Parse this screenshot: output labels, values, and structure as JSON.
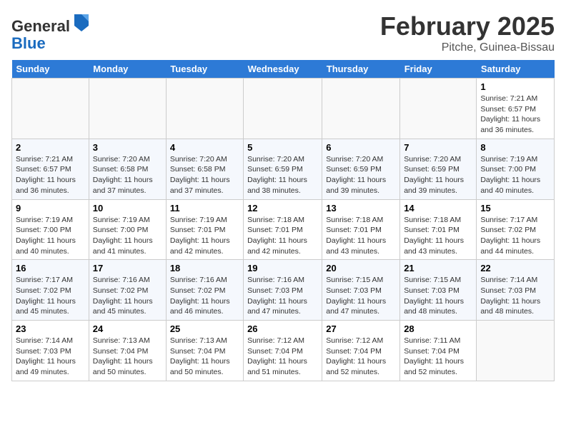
{
  "header": {
    "logo_general": "General",
    "logo_blue": "Blue",
    "title": "February 2025",
    "subtitle": "Pitche, Guinea-Bissau"
  },
  "days_of_week": [
    "Sunday",
    "Monday",
    "Tuesday",
    "Wednesday",
    "Thursday",
    "Friday",
    "Saturday"
  ],
  "weeks": [
    [
      {
        "day": "",
        "info": ""
      },
      {
        "day": "",
        "info": ""
      },
      {
        "day": "",
        "info": ""
      },
      {
        "day": "",
        "info": ""
      },
      {
        "day": "",
        "info": ""
      },
      {
        "day": "",
        "info": ""
      },
      {
        "day": "1",
        "info": "Sunrise: 7:21 AM\nSunset: 6:57 PM\nDaylight: 11 hours\nand 36 minutes."
      }
    ],
    [
      {
        "day": "2",
        "info": "Sunrise: 7:21 AM\nSunset: 6:57 PM\nDaylight: 11 hours\nand 36 minutes."
      },
      {
        "day": "3",
        "info": "Sunrise: 7:20 AM\nSunset: 6:58 PM\nDaylight: 11 hours\nand 37 minutes."
      },
      {
        "day": "4",
        "info": "Sunrise: 7:20 AM\nSunset: 6:58 PM\nDaylight: 11 hours\nand 37 minutes."
      },
      {
        "day": "5",
        "info": "Sunrise: 7:20 AM\nSunset: 6:59 PM\nDaylight: 11 hours\nand 38 minutes."
      },
      {
        "day": "6",
        "info": "Sunrise: 7:20 AM\nSunset: 6:59 PM\nDaylight: 11 hours\nand 39 minutes."
      },
      {
        "day": "7",
        "info": "Sunrise: 7:20 AM\nSunset: 6:59 PM\nDaylight: 11 hours\nand 39 minutes."
      },
      {
        "day": "8",
        "info": "Sunrise: 7:19 AM\nSunset: 7:00 PM\nDaylight: 11 hours\nand 40 minutes."
      }
    ],
    [
      {
        "day": "9",
        "info": "Sunrise: 7:19 AM\nSunset: 7:00 PM\nDaylight: 11 hours\nand 40 minutes."
      },
      {
        "day": "10",
        "info": "Sunrise: 7:19 AM\nSunset: 7:00 PM\nDaylight: 11 hours\nand 41 minutes."
      },
      {
        "day": "11",
        "info": "Sunrise: 7:19 AM\nSunset: 7:01 PM\nDaylight: 11 hours\nand 42 minutes."
      },
      {
        "day": "12",
        "info": "Sunrise: 7:18 AM\nSunset: 7:01 PM\nDaylight: 11 hours\nand 42 minutes."
      },
      {
        "day": "13",
        "info": "Sunrise: 7:18 AM\nSunset: 7:01 PM\nDaylight: 11 hours\nand 43 minutes."
      },
      {
        "day": "14",
        "info": "Sunrise: 7:18 AM\nSunset: 7:01 PM\nDaylight: 11 hours\nand 43 minutes."
      },
      {
        "day": "15",
        "info": "Sunrise: 7:17 AM\nSunset: 7:02 PM\nDaylight: 11 hours\nand 44 minutes."
      }
    ],
    [
      {
        "day": "16",
        "info": "Sunrise: 7:17 AM\nSunset: 7:02 PM\nDaylight: 11 hours\nand 45 minutes."
      },
      {
        "day": "17",
        "info": "Sunrise: 7:16 AM\nSunset: 7:02 PM\nDaylight: 11 hours\nand 45 minutes."
      },
      {
        "day": "18",
        "info": "Sunrise: 7:16 AM\nSunset: 7:02 PM\nDaylight: 11 hours\nand 46 minutes."
      },
      {
        "day": "19",
        "info": "Sunrise: 7:16 AM\nSunset: 7:03 PM\nDaylight: 11 hours\nand 47 minutes."
      },
      {
        "day": "20",
        "info": "Sunrise: 7:15 AM\nSunset: 7:03 PM\nDaylight: 11 hours\nand 47 minutes."
      },
      {
        "day": "21",
        "info": "Sunrise: 7:15 AM\nSunset: 7:03 PM\nDaylight: 11 hours\nand 48 minutes."
      },
      {
        "day": "22",
        "info": "Sunrise: 7:14 AM\nSunset: 7:03 PM\nDaylight: 11 hours\nand 48 minutes."
      }
    ],
    [
      {
        "day": "23",
        "info": "Sunrise: 7:14 AM\nSunset: 7:03 PM\nDaylight: 11 hours\nand 49 minutes."
      },
      {
        "day": "24",
        "info": "Sunrise: 7:13 AM\nSunset: 7:04 PM\nDaylight: 11 hours\nand 50 minutes."
      },
      {
        "day": "25",
        "info": "Sunrise: 7:13 AM\nSunset: 7:04 PM\nDaylight: 11 hours\nand 50 minutes."
      },
      {
        "day": "26",
        "info": "Sunrise: 7:12 AM\nSunset: 7:04 PM\nDaylight: 11 hours\nand 51 minutes."
      },
      {
        "day": "27",
        "info": "Sunrise: 7:12 AM\nSunset: 7:04 PM\nDaylight: 11 hours\nand 52 minutes."
      },
      {
        "day": "28",
        "info": "Sunrise: 7:11 AM\nSunset: 7:04 PM\nDaylight: 11 hours\nand 52 minutes."
      },
      {
        "day": "",
        "info": ""
      }
    ]
  ]
}
